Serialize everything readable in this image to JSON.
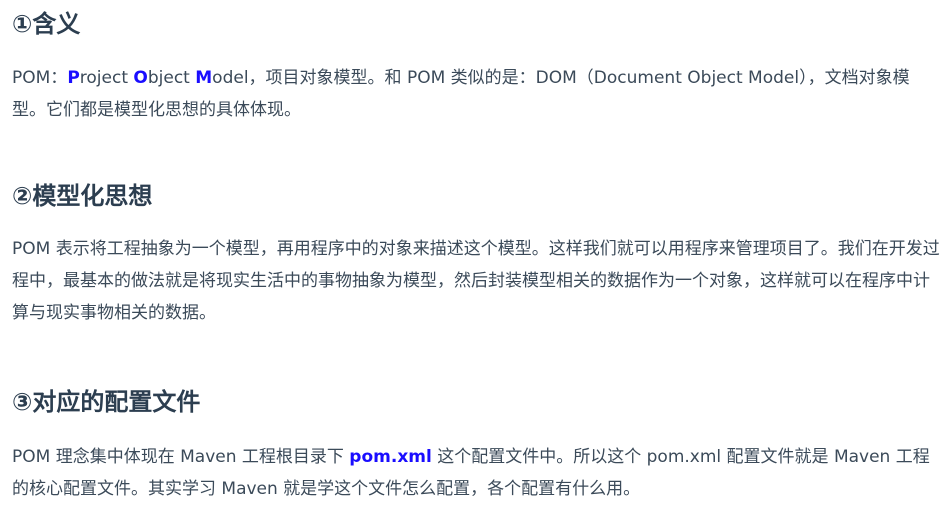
{
  "sections": [
    {
      "heading": "①含义",
      "p_a": "POM：",
      "b1": "P",
      "t1": "roject ",
      "b2": "O",
      "t2": "bject ",
      "b3": "M",
      "t3": "odel，项目对象模型。和 POM 类似的是：DOM（Document Object Model），文档对象模型。它们都是模型化思想的具体体现。"
    },
    {
      "heading": "②模型化思想",
      "text": "POM 表示将工程抽象为一个模型，再用程序中的对象来描述这个模型。这样我们就可以用程序来管理项目了。我们在开发过程中，最基本的做法就是将现实生活中的事物抽象为模型，然后封装模型相关的数据作为一个对象，这样就可以在程序中计算与现实事物相关的数据。"
    },
    {
      "heading": "③对应的配置文件",
      "p_a": "POM 理念集中体现在 Maven 工程根目录下 ",
      "bold": "pom.xml",
      "p_b": " 这个配置文件中。所以这个 pom.xml 配置文件就是 Maven 工程的核心配置文件。其实学习 Maven 就是学这个文件怎么配置，各个配置有什么用。"
    }
  ]
}
